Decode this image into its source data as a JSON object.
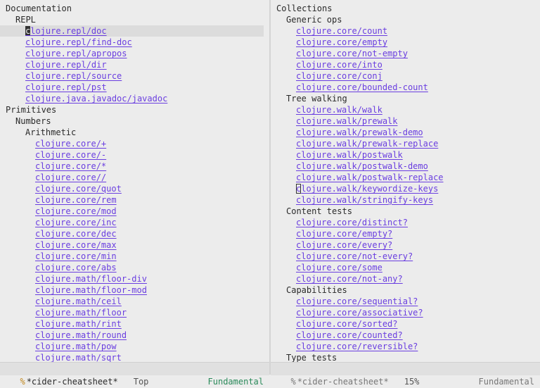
{
  "left_pane": {
    "lines": [
      {
        "depth": 0,
        "type": "heading",
        "text": "Documentation"
      },
      {
        "depth": 1,
        "type": "heading",
        "text": "REPL"
      },
      {
        "depth": 2,
        "type": "link",
        "text": "clojure.repl/doc",
        "current": true,
        "cursor": "block"
      },
      {
        "depth": 2,
        "type": "link",
        "text": "clojure.repl/find-doc"
      },
      {
        "depth": 2,
        "type": "link",
        "text": "clojure.repl/apropos"
      },
      {
        "depth": 2,
        "type": "link",
        "text": "clojure.repl/dir"
      },
      {
        "depth": 2,
        "type": "link",
        "text": "clojure.repl/source"
      },
      {
        "depth": 2,
        "type": "link",
        "text": "clojure.repl/pst"
      },
      {
        "depth": 2,
        "type": "link",
        "text": "clojure.java.javadoc/javadoc"
      },
      {
        "depth": 0,
        "type": "heading",
        "text": "Primitives"
      },
      {
        "depth": 1,
        "type": "heading",
        "text": "Numbers"
      },
      {
        "depth": 2,
        "type": "heading",
        "text": "Arithmetic"
      },
      {
        "depth": 3,
        "type": "link",
        "text": "clojure.core/+"
      },
      {
        "depth": 3,
        "type": "link",
        "text": "clojure.core/-"
      },
      {
        "depth": 3,
        "type": "link",
        "text": "clojure.core/*"
      },
      {
        "depth": 3,
        "type": "link",
        "text": "clojure.core//"
      },
      {
        "depth": 3,
        "type": "link",
        "text": "clojure.core/quot"
      },
      {
        "depth": 3,
        "type": "link",
        "text": "clojure.core/rem"
      },
      {
        "depth": 3,
        "type": "link",
        "text": "clojure.core/mod"
      },
      {
        "depth": 3,
        "type": "link",
        "text": "clojure.core/inc"
      },
      {
        "depth": 3,
        "type": "link",
        "text": "clojure.core/dec"
      },
      {
        "depth": 3,
        "type": "link",
        "text": "clojure.core/max"
      },
      {
        "depth": 3,
        "type": "link",
        "text": "clojure.core/min"
      },
      {
        "depth": 3,
        "type": "link",
        "text": "clojure.core/abs"
      },
      {
        "depth": 3,
        "type": "link",
        "text": "clojure.math/floor-div"
      },
      {
        "depth": 3,
        "type": "link",
        "text": "clojure.math/floor-mod"
      },
      {
        "depth": 3,
        "type": "link",
        "text": "clojure.math/ceil"
      },
      {
        "depth": 3,
        "type": "link",
        "text": "clojure.math/floor"
      },
      {
        "depth": 3,
        "type": "link",
        "text": "clojure.math/rint"
      },
      {
        "depth": 3,
        "type": "link",
        "text": "clojure.math/round"
      },
      {
        "depth": 3,
        "type": "link",
        "text": "clojure.math/pow"
      },
      {
        "depth": 3,
        "type": "link",
        "text": "clojure.math/sqrt"
      }
    ]
  },
  "right_pane": {
    "lines": [
      {
        "depth": 0,
        "type": "heading",
        "text": "Collections"
      },
      {
        "depth": 1,
        "type": "heading",
        "text": "Generic ops"
      },
      {
        "depth": 2,
        "type": "link",
        "text": "clojure.core/count"
      },
      {
        "depth": 2,
        "type": "link",
        "text": "clojure.core/empty"
      },
      {
        "depth": 2,
        "type": "link",
        "text": "clojure.core/not-empty"
      },
      {
        "depth": 2,
        "type": "link",
        "text": "clojure.core/into"
      },
      {
        "depth": 2,
        "type": "link",
        "text": "clojure.core/conj"
      },
      {
        "depth": 2,
        "type": "link",
        "text": "clojure.core/bounded-count"
      },
      {
        "depth": 1,
        "type": "heading",
        "text": "Tree walking"
      },
      {
        "depth": 2,
        "type": "link",
        "text": "clojure.walk/walk"
      },
      {
        "depth": 2,
        "type": "link",
        "text": "clojure.walk/prewalk"
      },
      {
        "depth": 2,
        "type": "link",
        "text": "clojure.walk/prewalk-demo"
      },
      {
        "depth": 2,
        "type": "link",
        "text": "clojure.walk/prewalk-replace"
      },
      {
        "depth": 2,
        "type": "link",
        "text": "clojure.walk/postwalk"
      },
      {
        "depth": 2,
        "type": "link",
        "text": "clojure.walk/postwalk-demo"
      },
      {
        "depth": 2,
        "type": "link",
        "text": "clojure.walk/postwalk-replace"
      },
      {
        "depth": 2,
        "type": "link",
        "text": "clojure.walk/keywordize-keys",
        "cursor": "box"
      },
      {
        "depth": 2,
        "type": "link",
        "text": "clojure.walk/stringify-keys"
      },
      {
        "depth": 1,
        "type": "heading",
        "text": "Content tests"
      },
      {
        "depth": 2,
        "type": "link",
        "text": "clojure.core/distinct?"
      },
      {
        "depth": 2,
        "type": "link",
        "text": "clojure.core/empty?"
      },
      {
        "depth": 2,
        "type": "link",
        "text": "clojure.core/every?"
      },
      {
        "depth": 2,
        "type": "link",
        "text": "clojure.core/not-every?"
      },
      {
        "depth": 2,
        "type": "link",
        "text": "clojure.core/some"
      },
      {
        "depth": 2,
        "type": "link",
        "text": "clojure.core/not-any?"
      },
      {
        "depth": 1,
        "type": "heading",
        "text": "Capabilities"
      },
      {
        "depth": 2,
        "type": "link",
        "text": "clojure.core/sequential?"
      },
      {
        "depth": 2,
        "type": "link",
        "text": "clojure.core/associative?"
      },
      {
        "depth": 2,
        "type": "link",
        "text": "clojure.core/sorted?"
      },
      {
        "depth": 2,
        "type": "link",
        "text": "clojure.core/counted?"
      },
      {
        "depth": 2,
        "type": "link",
        "text": "clojure.core/reversible?"
      },
      {
        "depth": 1,
        "type": "heading",
        "text": "Type tests"
      }
    ]
  },
  "modeline_left": {
    "modified_indicator": "%",
    "buffer_name": "*cider-cheatsheet*",
    "position": "Top",
    "major_mode": "Fundamental"
  },
  "modeline_right": {
    "modified_indicator": "%",
    "buffer_name": "*cider-cheatsheet*",
    "position": "15%",
    "major_mode": "Fundamental"
  },
  "colors": {
    "background": "#ececec",
    "link": "#6a3ee0",
    "text": "#2a2a2a",
    "highlight_line": "#dcdcdc",
    "mode_name_active": "#2a8a5a"
  }
}
